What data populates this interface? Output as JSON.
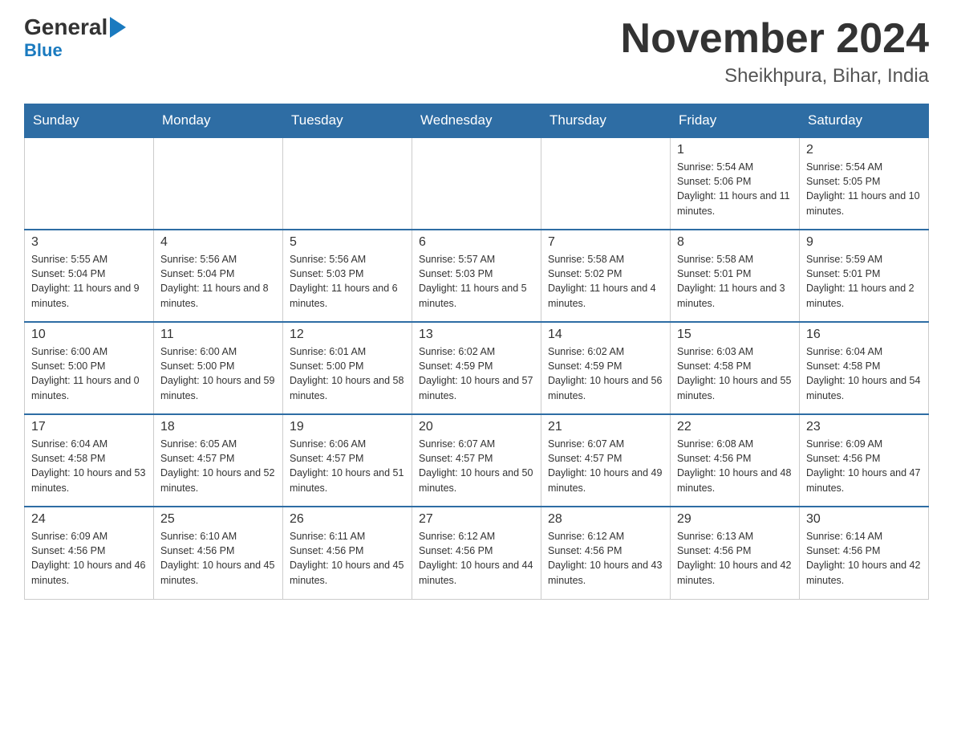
{
  "header": {
    "logo_general": "General",
    "logo_blue": "Blue",
    "month_title": "November 2024",
    "location": "Sheikhpura, Bihar, India"
  },
  "days_of_week": [
    "Sunday",
    "Monday",
    "Tuesday",
    "Wednesday",
    "Thursday",
    "Friday",
    "Saturday"
  ],
  "weeks": [
    {
      "days": [
        {
          "number": "",
          "info": ""
        },
        {
          "number": "",
          "info": ""
        },
        {
          "number": "",
          "info": ""
        },
        {
          "number": "",
          "info": ""
        },
        {
          "number": "",
          "info": ""
        },
        {
          "number": "1",
          "info": "Sunrise: 5:54 AM\nSunset: 5:06 PM\nDaylight: 11 hours and 11 minutes."
        },
        {
          "number": "2",
          "info": "Sunrise: 5:54 AM\nSunset: 5:05 PM\nDaylight: 11 hours and 10 minutes."
        }
      ]
    },
    {
      "days": [
        {
          "number": "3",
          "info": "Sunrise: 5:55 AM\nSunset: 5:04 PM\nDaylight: 11 hours and 9 minutes."
        },
        {
          "number": "4",
          "info": "Sunrise: 5:56 AM\nSunset: 5:04 PM\nDaylight: 11 hours and 8 minutes."
        },
        {
          "number": "5",
          "info": "Sunrise: 5:56 AM\nSunset: 5:03 PM\nDaylight: 11 hours and 6 minutes."
        },
        {
          "number": "6",
          "info": "Sunrise: 5:57 AM\nSunset: 5:03 PM\nDaylight: 11 hours and 5 minutes."
        },
        {
          "number": "7",
          "info": "Sunrise: 5:58 AM\nSunset: 5:02 PM\nDaylight: 11 hours and 4 minutes."
        },
        {
          "number": "8",
          "info": "Sunrise: 5:58 AM\nSunset: 5:01 PM\nDaylight: 11 hours and 3 minutes."
        },
        {
          "number": "9",
          "info": "Sunrise: 5:59 AM\nSunset: 5:01 PM\nDaylight: 11 hours and 2 minutes."
        }
      ]
    },
    {
      "days": [
        {
          "number": "10",
          "info": "Sunrise: 6:00 AM\nSunset: 5:00 PM\nDaylight: 11 hours and 0 minutes."
        },
        {
          "number": "11",
          "info": "Sunrise: 6:00 AM\nSunset: 5:00 PM\nDaylight: 10 hours and 59 minutes."
        },
        {
          "number": "12",
          "info": "Sunrise: 6:01 AM\nSunset: 5:00 PM\nDaylight: 10 hours and 58 minutes."
        },
        {
          "number": "13",
          "info": "Sunrise: 6:02 AM\nSunset: 4:59 PM\nDaylight: 10 hours and 57 minutes."
        },
        {
          "number": "14",
          "info": "Sunrise: 6:02 AM\nSunset: 4:59 PM\nDaylight: 10 hours and 56 minutes."
        },
        {
          "number": "15",
          "info": "Sunrise: 6:03 AM\nSunset: 4:58 PM\nDaylight: 10 hours and 55 minutes."
        },
        {
          "number": "16",
          "info": "Sunrise: 6:04 AM\nSunset: 4:58 PM\nDaylight: 10 hours and 54 minutes."
        }
      ]
    },
    {
      "days": [
        {
          "number": "17",
          "info": "Sunrise: 6:04 AM\nSunset: 4:58 PM\nDaylight: 10 hours and 53 minutes."
        },
        {
          "number": "18",
          "info": "Sunrise: 6:05 AM\nSunset: 4:57 PM\nDaylight: 10 hours and 52 minutes."
        },
        {
          "number": "19",
          "info": "Sunrise: 6:06 AM\nSunset: 4:57 PM\nDaylight: 10 hours and 51 minutes."
        },
        {
          "number": "20",
          "info": "Sunrise: 6:07 AM\nSunset: 4:57 PM\nDaylight: 10 hours and 50 minutes."
        },
        {
          "number": "21",
          "info": "Sunrise: 6:07 AM\nSunset: 4:57 PM\nDaylight: 10 hours and 49 minutes."
        },
        {
          "number": "22",
          "info": "Sunrise: 6:08 AM\nSunset: 4:56 PM\nDaylight: 10 hours and 48 minutes."
        },
        {
          "number": "23",
          "info": "Sunrise: 6:09 AM\nSunset: 4:56 PM\nDaylight: 10 hours and 47 minutes."
        }
      ]
    },
    {
      "days": [
        {
          "number": "24",
          "info": "Sunrise: 6:09 AM\nSunset: 4:56 PM\nDaylight: 10 hours and 46 minutes."
        },
        {
          "number": "25",
          "info": "Sunrise: 6:10 AM\nSunset: 4:56 PM\nDaylight: 10 hours and 45 minutes."
        },
        {
          "number": "26",
          "info": "Sunrise: 6:11 AM\nSunset: 4:56 PM\nDaylight: 10 hours and 45 minutes."
        },
        {
          "number": "27",
          "info": "Sunrise: 6:12 AM\nSunset: 4:56 PM\nDaylight: 10 hours and 44 minutes."
        },
        {
          "number": "28",
          "info": "Sunrise: 6:12 AM\nSunset: 4:56 PM\nDaylight: 10 hours and 43 minutes."
        },
        {
          "number": "29",
          "info": "Sunrise: 6:13 AM\nSunset: 4:56 PM\nDaylight: 10 hours and 42 minutes."
        },
        {
          "number": "30",
          "info": "Sunrise: 6:14 AM\nSunset: 4:56 PM\nDaylight: 10 hours and 42 minutes."
        }
      ]
    }
  ]
}
